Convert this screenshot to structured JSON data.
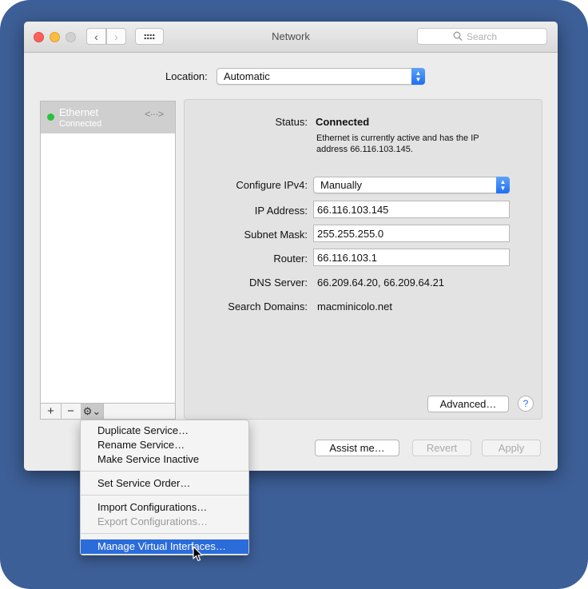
{
  "window": {
    "title": "Network"
  },
  "toolbar": {
    "search_placeholder": "Search"
  },
  "location": {
    "label": "Location:",
    "value": "Automatic"
  },
  "services": [
    {
      "name": "Ethernet",
      "status": "Connected",
      "color": "#29c13a"
    }
  ],
  "sidebar_buttons": {
    "add": "+",
    "remove": "−"
  },
  "detail": {
    "status_label": "Status:",
    "status_value": "Connected",
    "status_desc": "Ethernet is currently active and has the IP address 66.116.103.145.",
    "configure_label": "Configure IPv4:",
    "configure_value": "Manually",
    "ip_label": "IP Address:",
    "ip_value": "66.116.103.145",
    "subnet_label": "Subnet Mask:",
    "subnet_value": "255.255.255.0",
    "router_label": "Router:",
    "router_value": "66.116.103.1",
    "dns_label": "DNS Server:",
    "dns_value": "66.209.64.20, 66.209.64.21",
    "search_domains_label": "Search Domains:",
    "search_domains_value": "macminicolo.net",
    "advanced_button": "Advanced…",
    "help": "?"
  },
  "footer": {
    "assist": "Assist me…",
    "revert": "Revert",
    "apply": "Apply"
  },
  "menu": {
    "items": [
      "Duplicate Service…",
      "Rename Service…",
      "Make Service Inactive",
      "Set Service Order…",
      "Import Configurations…",
      "Export Configurations…",
      "Manage Virtual Interfaces…"
    ]
  },
  "colors": {
    "accent": "#2b6cdb",
    "background": "#3d5f97"
  }
}
